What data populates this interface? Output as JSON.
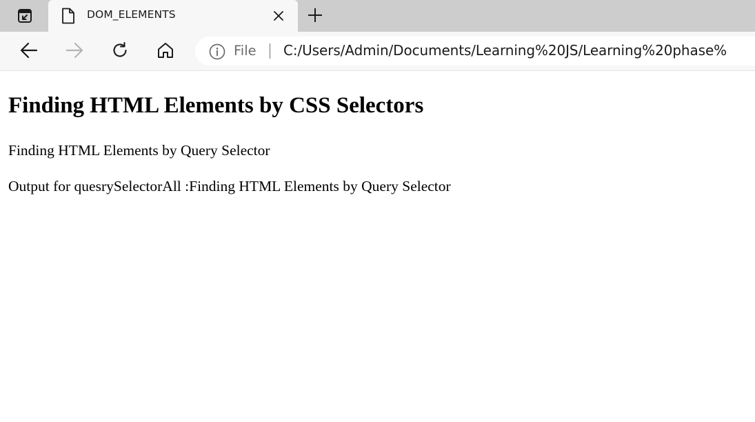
{
  "browser": {
    "tab": {
      "title": "DOM_ELEMENTS",
      "favicon": "page-icon"
    },
    "toolbar": {
      "back_icon": "arrow-left-icon",
      "forward_icon": "arrow-right-icon",
      "refresh_icon": "refresh-icon",
      "home_icon": "home-icon"
    },
    "address_bar": {
      "security_icon": "info-icon",
      "scheme_label": "File",
      "url": "C:/Users/Admin/Documents/Learning%20JS/Learning%20phase%"
    }
  },
  "page": {
    "heading": "Finding HTML Elements by CSS Selectors",
    "paragraphs": [
      "Finding HTML Elements by Query Selector",
      "Output for quesrySelectorAll :Finding HTML Elements by Query Selector"
    ]
  },
  "colors": {
    "tabstrip_bg": "#cdcdcd",
    "toolbar_bg": "#f7f7f7",
    "omnibox_bg": "#ffffff",
    "forward_disabled": "#b5b5b5"
  }
}
